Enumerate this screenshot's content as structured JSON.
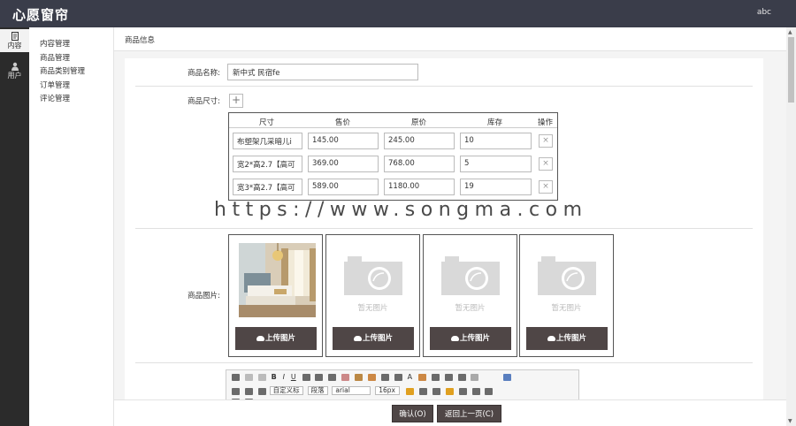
{
  "header": {
    "logo": "心愿窗帘",
    "user": "abc"
  },
  "leftbar": {
    "items": [
      {
        "label": "内容",
        "icon": "document-icon",
        "active": true
      },
      {
        "label": "用户",
        "icon": "user-icon",
        "active": false
      }
    ]
  },
  "subnav": {
    "items": [
      "内容管理",
      "商品管理",
      "商品类别管理",
      "订单管理",
      "评论管理"
    ]
  },
  "breadcrumb": "商品信息",
  "form": {
    "name_label": "商品名称:",
    "name_value": "新中式 民宿fe",
    "size_label": "商品尺寸:",
    "add_size": "+",
    "size_table": {
      "headers": [
        "尺寸",
        "售价",
        "原价",
        "库存",
        "操作"
      ],
      "rows": [
        {
          "size": "布塑架几采暗儿i",
          "price": "145.00",
          "original": "245.00",
          "stock": "10"
        },
        {
          "size": "宽2*高2.7【高可",
          "price": "369.00",
          "original": "768.00",
          "stock": "5"
        },
        {
          "size": "宽3*高2.7【高可",
          "price": "589.00",
          "original": "1180.00",
          "stock": "19"
        }
      ],
      "delete_symbol": "×"
    },
    "image_label": "商品图片:",
    "images": [
      {
        "has_image": true,
        "no_image_text": "",
        "upload_label": "上传图片"
      },
      {
        "has_image": false,
        "no_image_text": "暂无图片",
        "upload_label": "上传图片"
      },
      {
        "has_image": false,
        "no_image_text": "暂无图片",
        "upload_label": "上传图片"
      },
      {
        "has_image": false,
        "no_image_text": "暂无图片",
        "upload_label": "上传图片"
      }
    ],
    "editor": {
      "row1": [
        "B",
        "I",
        "U",
        "A"
      ],
      "row2": {
        "style": "自定义标",
        "paragraph": "段落",
        "font": "arial",
        "size": "16px"
      }
    }
  },
  "watermark": "https://www.songma.com",
  "footer": {
    "confirm": "确认(O)",
    "back": "返回上一页(C)"
  },
  "colors": {
    "topbar": "#3a3d4a",
    "sidebar": "#2b2b2b",
    "button": "#4f4646"
  }
}
